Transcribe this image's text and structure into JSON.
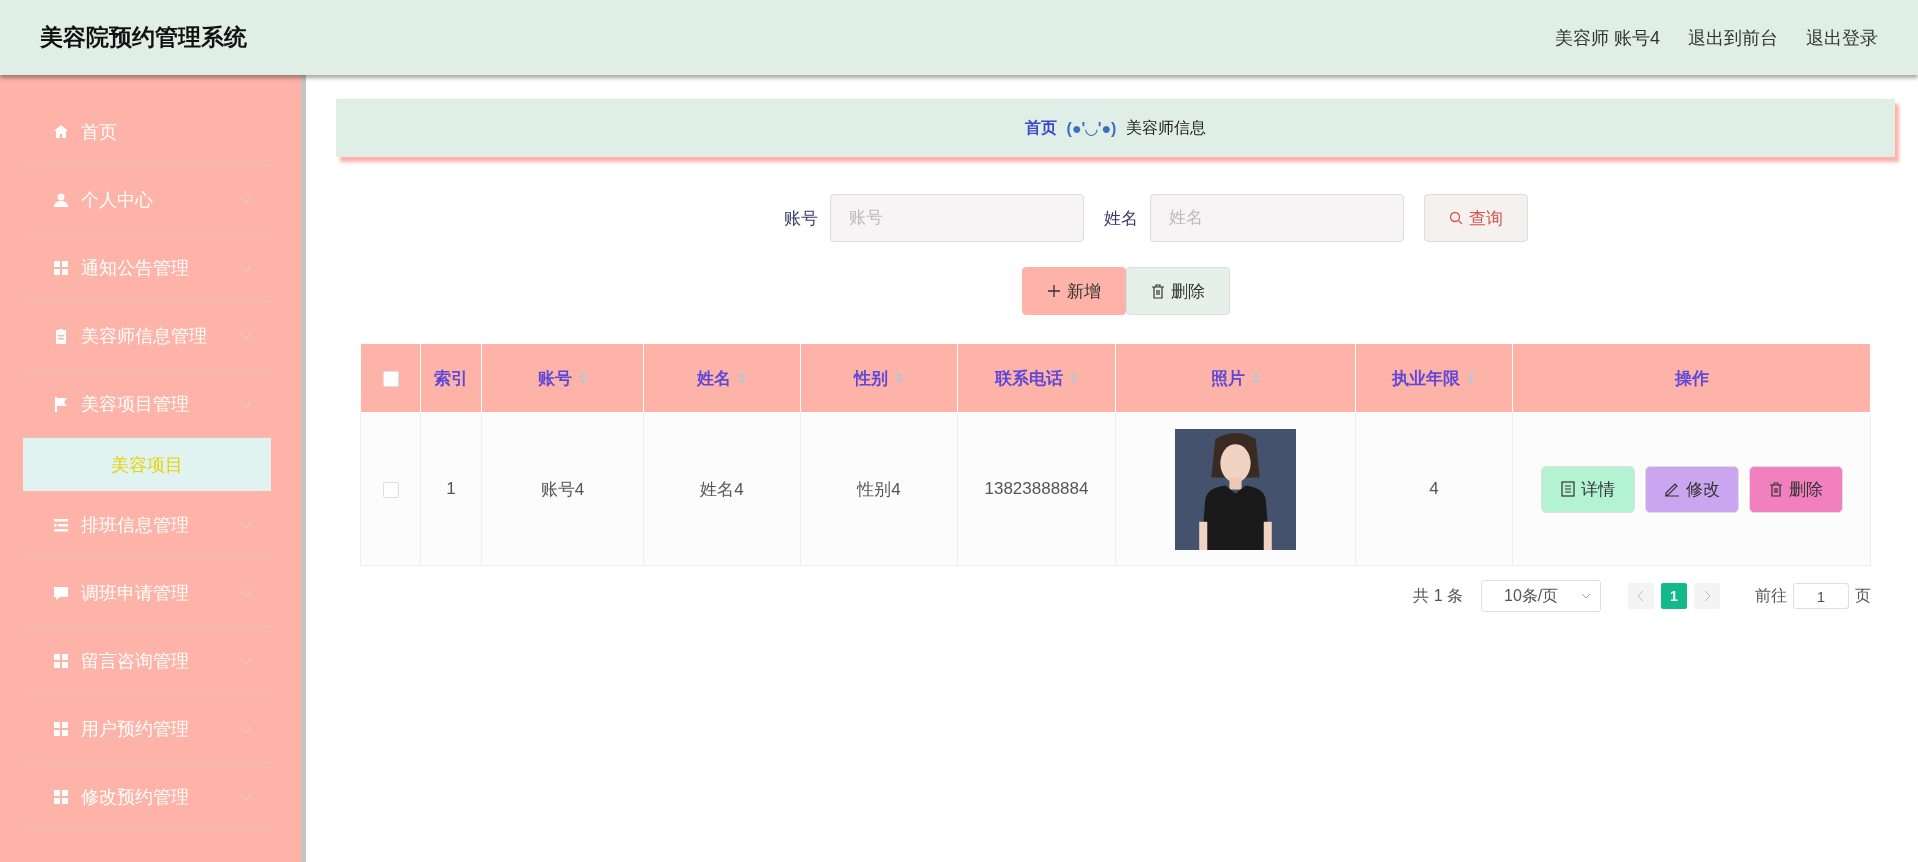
{
  "header": {
    "title": "美容院预约管理系统",
    "links": [
      "美容师 账号4",
      "退出到前台",
      "退出登录"
    ]
  },
  "sidebar": {
    "items": [
      {
        "label": "首页",
        "kind": "link"
      },
      {
        "label": "个人中心",
        "kind": "menu"
      },
      {
        "label": "通知公告管理",
        "kind": "menu"
      },
      {
        "label": "美容师信息管理",
        "kind": "menu"
      },
      {
        "label": "美容项目管理",
        "kind": "menu",
        "children": [
          {
            "label": "美容项目",
            "selected": true
          }
        ]
      },
      {
        "label": "排班信息管理",
        "kind": "menu"
      },
      {
        "label": "调班申请管理",
        "kind": "menu"
      },
      {
        "label": "留言咨询管理",
        "kind": "menu"
      },
      {
        "label": "用户预约管理",
        "kind": "menu"
      },
      {
        "label": "修改预约管理",
        "kind": "menu"
      }
    ]
  },
  "breadcrumb": [
    {
      "label": "首页",
      "kind": "home"
    },
    {
      "label": "(●'◡'●)",
      "kind": "separator"
    },
    {
      "label": "美容师信息",
      "kind": "current"
    }
  ],
  "search": {
    "fields": [
      {
        "label": "账号",
        "placeholder": "账号"
      },
      {
        "label": "姓名",
        "placeholder": "姓名"
      }
    ],
    "button": "查询"
  },
  "actions": [
    {
      "label": "新增",
      "kind": "add"
    },
    {
      "label": "删除",
      "kind": "delete"
    }
  ],
  "table": {
    "select_all": false,
    "columns": [
      {
        "label": "索引",
        "sortable": false
      },
      {
        "label": "账号",
        "sortable": true
      },
      {
        "label": "姓名",
        "sortable": true
      },
      {
        "label": "性别",
        "sortable": true
      },
      {
        "label": "联系电话",
        "sortable": true
      },
      {
        "label": "照片",
        "sortable": true
      },
      {
        "label": "执业年限",
        "sortable": true
      },
      {
        "label": "操作",
        "sortable": false
      }
    ],
    "rows": [
      {
        "checked": false,
        "cells": [
          {
            "kind": "text",
            "text": "1"
          },
          {
            "kind": "text",
            "text": "账号4"
          },
          {
            "kind": "text",
            "text": "姓名4"
          },
          {
            "kind": "text",
            "text": "性别4"
          },
          {
            "kind": "text",
            "text": "13823888884"
          },
          {
            "kind": "picture"
          },
          {
            "kind": "text",
            "text": "4"
          }
        ],
        "actions": [
          {
            "label": "详情",
            "kind": "detail"
          },
          {
            "label": "修改",
            "kind": "edit"
          },
          {
            "label": "删除",
            "kind": "delete"
          }
        ]
      }
    ]
  },
  "pagination": {
    "total": "共 1 条",
    "page_size": "10条/页",
    "pages": [
      {
        "label": "1",
        "selected": true
      }
    ],
    "goto_label": "前往",
    "goto_value": "1",
    "page_suffix": "页"
  }
}
